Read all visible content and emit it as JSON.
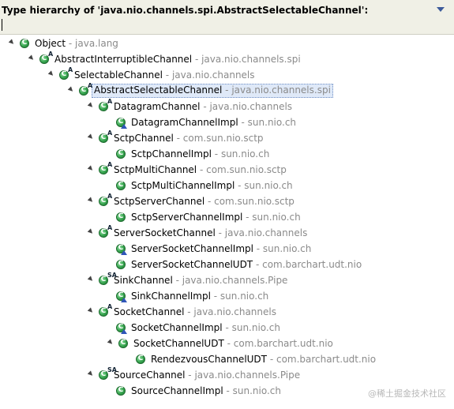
{
  "header": {
    "title": "Type hierarchy of 'java.nio.channels.spi.AbstractSelectableChannel':",
    "filter_value": ""
  },
  "tree": [
    {
      "name": "Object",
      "pkg": " - java.lang",
      "depth": 0,
      "expanded": true,
      "mod": "",
      "impl": false
    },
    {
      "name": "AbstractInterruptibleChannel",
      "pkg": " - java.nio.channels.spi",
      "depth": 1,
      "expanded": true,
      "mod": "A",
      "impl": false
    },
    {
      "name": "SelectableChannel",
      "pkg": " - java.nio.channels",
      "depth": 2,
      "expanded": true,
      "mod": "A",
      "impl": false
    },
    {
      "name": "AbstractSelectableChannel",
      "pkg": " - java.nio.channels.spi",
      "depth": 3,
      "expanded": true,
      "mod": "A",
      "impl": false,
      "selected": true
    },
    {
      "name": "DatagramChannel",
      "pkg": " - java.nio.channels",
      "depth": 4,
      "expanded": true,
      "mod": "A",
      "impl": false
    },
    {
      "name": "DatagramChannelImpl",
      "pkg": " - sun.nio.ch",
      "depth": 5,
      "expanded": false,
      "mod": "",
      "impl": true
    },
    {
      "name": "SctpChannel",
      "pkg": " - com.sun.nio.sctp",
      "depth": 4,
      "expanded": true,
      "mod": "A",
      "impl": false
    },
    {
      "name": "SctpChannelImpl",
      "pkg": " - sun.nio.ch",
      "depth": 5,
      "expanded": false,
      "mod": "",
      "impl": false
    },
    {
      "name": "SctpMultiChannel",
      "pkg": " - com.sun.nio.sctp",
      "depth": 4,
      "expanded": true,
      "mod": "A",
      "impl": false
    },
    {
      "name": "SctpMultiChannelImpl",
      "pkg": " - sun.nio.ch",
      "depth": 5,
      "expanded": false,
      "mod": "",
      "impl": false
    },
    {
      "name": "SctpServerChannel",
      "pkg": " - com.sun.nio.sctp",
      "depth": 4,
      "expanded": true,
      "mod": "A",
      "impl": false
    },
    {
      "name": "SctpServerChannelImpl",
      "pkg": " - sun.nio.ch",
      "depth": 5,
      "expanded": false,
      "mod": "",
      "impl": false
    },
    {
      "name": "ServerSocketChannel",
      "pkg": " - java.nio.channels",
      "depth": 4,
      "expanded": true,
      "mod": "A",
      "impl": false
    },
    {
      "name": "ServerSocketChannelImpl",
      "pkg": " - sun.nio.ch",
      "depth": 5,
      "expanded": false,
      "mod": "",
      "impl": true
    },
    {
      "name": "ServerSocketChannelUDT",
      "pkg": " - com.barchart.udt.nio",
      "depth": 5,
      "expanded": false,
      "mod": "",
      "impl": false
    },
    {
      "name": "SinkChannel",
      "pkg": " - java.nio.channels.Pipe",
      "depth": 4,
      "expanded": true,
      "mod": "SA",
      "impl": false
    },
    {
      "name": "SinkChannelImpl",
      "pkg": " - sun.nio.ch",
      "depth": 5,
      "expanded": false,
      "mod": "",
      "impl": true
    },
    {
      "name": "SocketChannel",
      "pkg": " - java.nio.channels",
      "depth": 4,
      "expanded": true,
      "mod": "A",
      "impl": false
    },
    {
      "name": "SocketChannelImpl",
      "pkg": " - sun.nio.ch",
      "depth": 5,
      "expanded": false,
      "mod": "",
      "impl": true
    },
    {
      "name": "SocketChannelUDT",
      "pkg": " - com.barchart.udt.nio",
      "depth": 5,
      "expanded": true,
      "mod": "",
      "impl": false
    },
    {
      "name": "RendezvousChannelUDT",
      "pkg": " - com.barchart.udt.nio",
      "depth": 6,
      "expanded": false,
      "mod": "",
      "impl": false
    },
    {
      "name": "SourceChannel",
      "pkg": " - java.nio.channels.Pipe",
      "depth": 4,
      "expanded": true,
      "mod": "SA",
      "impl": false
    },
    {
      "name": "SourceChannelImpl",
      "pkg": " - sun.nio.ch",
      "depth": 5,
      "expanded": false,
      "mod": "",
      "impl": false
    }
  ],
  "watermark": "@稀土掘金技术社区"
}
